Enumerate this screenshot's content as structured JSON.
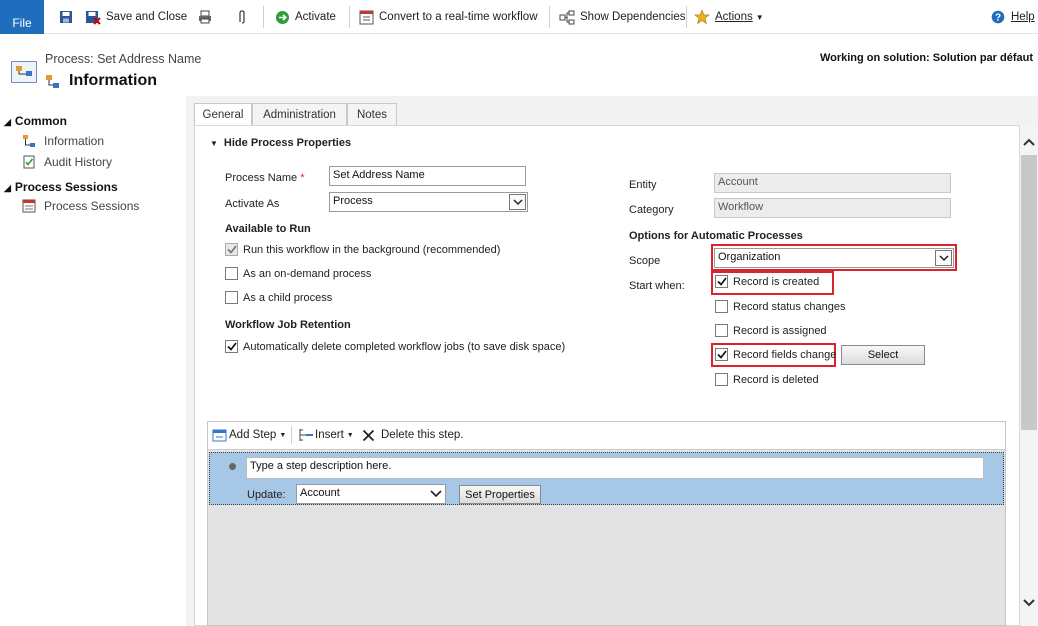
{
  "ribbon": {
    "file": "File",
    "save_close": "Save and Close",
    "activate": "Activate",
    "convert": "Convert to a real-time workflow",
    "dependencies": "Show Dependencies",
    "actions": "Actions",
    "help": "Help"
  },
  "header": {
    "subtitle": "Process: Set Address Name",
    "title": "Information",
    "solution": "Working on solution: Solution par défaut"
  },
  "nav": {
    "common": "Common",
    "information": "Information",
    "audit": "Audit History",
    "sessions_group": "Process Sessions",
    "sessions": "Process Sessions"
  },
  "tabs": [
    "General",
    "Administration",
    "Notes"
  ],
  "section": {
    "title": "Hide Process Properties"
  },
  "form": {
    "process_name_label": "Process Name",
    "process_name": "Set Address Name",
    "activate_as_label": "Activate As",
    "activate_as": "Process",
    "available_title": "Available to Run",
    "opt_background": "Run this workflow in the background (recommended)",
    "opt_ondemand": "As an on-demand process",
    "opt_child": "As a child process",
    "retention_title": "Workflow Job Retention",
    "opt_delete": "Automatically delete completed workflow jobs (to save disk space)",
    "entity_label": "Entity",
    "entity": "Account",
    "category_label": "Category",
    "category": "Workflow",
    "options_title": "Options for Automatic Processes",
    "scope_label": "Scope",
    "scope": "Organization",
    "start_label": "Start when:",
    "start_created": "Record is created",
    "start_status": "Record status changes",
    "start_assigned": "Record is assigned",
    "start_fields": "Record fields change",
    "start_deleted": "Record is deleted",
    "select_btn": "Select"
  },
  "designer": {
    "add_step": "Add Step",
    "insert": "Insert",
    "delete": "Delete this step.",
    "step_desc": "Type a step description here.",
    "update_label": "Update:",
    "update_value": "Account",
    "set_props": "Set Properties"
  },
  "colors": {
    "file_btn": "#1f6ebe",
    "highlight": "#d9232e",
    "step_bg": "#a7c7e7"
  }
}
